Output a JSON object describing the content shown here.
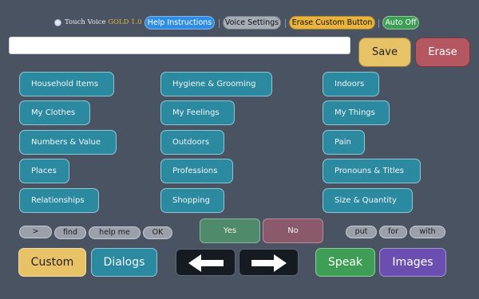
{
  "app": {
    "title_prefix": "Touch Voice",
    "title_gold": "GOLD 1.0"
  },
  "topbar": {
    "help_label": "Help Instructions",
    "voice_label": "Voice Settings",
    "erase_custom_label": "Erase Custom Button",
    "auto_label": "Auto Off"
  },
  "message": {
    "value": ""
  },
  "actions": {
    "save_label": "Save",
    "erase_label": "Erase"
  },
  "categories": [
    "Household Items",
    "Hygiene & Grooming",
    "Indoors",
    "My Clothes",
    "My Feelings",
    "My Things",
    "Numbers & Value",
    "Outdoors",
    "Pain",
    "Places",
    "Professions",
    "Pronouns & Titles",
    "Relationships",
    "Shopping",
    "Size & Quantity"
  ],
  "quickwords": {
    "next": ">",
    "left": [
      "find",
      "help me",
      "OK"
    ],
    "yes": "Yes",
    "no": "No",
    "right": [
      "put",
      "for",
      "with"
    ]
  },
  "bottom": {
    "custom_label": "Custom",
    "dialogs_label": "Dialogs",
    "speak_label": "Speak",
    "images_label": "Images"
  },
  "colors": {
    "background": "#4a5361",
    "category": "#2c8aa0",
    "save": "#e8c266",
    "erase": "#b45760",
    "speak": "#3e9e56",
    "images": "#6b4fb0"
  }
}
